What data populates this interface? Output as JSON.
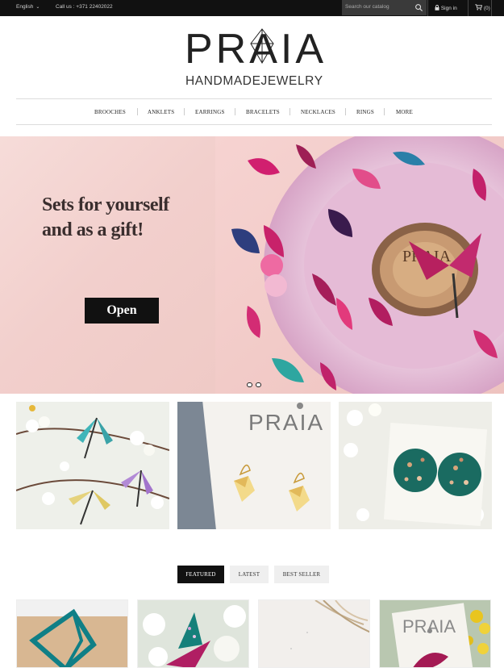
{
  "topbar": {
    "language": "English",
    "call": "Call us : +371 22402022",
    "search_placeholder": "Search our catalog",
    "signin": "Sign in",
    "cart": "(0)"
  },
  "logo": {
    "name": "PRAIA",
    "subtitle": "HANDMADEJEWELRY"
  },
  "nav": {
    "items": [
      "BROOCHES",
      "ANKLETS",
      "EARRINGS",
      "BRACELETS",
      "NECKLACES",
      "RINGS",
      "MORE"
    ]
  },
  "hero": {
    "tagline_line1": "Sets for yourself",
    "tagline_line2": "and as a gift!",
    "button": "Open",
    "plate_text": "PRAIA"
  },
  "banners": {
    "card_text": "PRAIA"
  },
  "tabs": [
    "FEATURED",
    "LATEST",
    "BEST SELLER"
  ],
  "colors": {
    "topbar_bg": "#111111",
    "accent_teal": "#1f8c86",
    "accent_magenta": "#c0226a",
    "hero_pink": "#f2cfcc"
  }
}
